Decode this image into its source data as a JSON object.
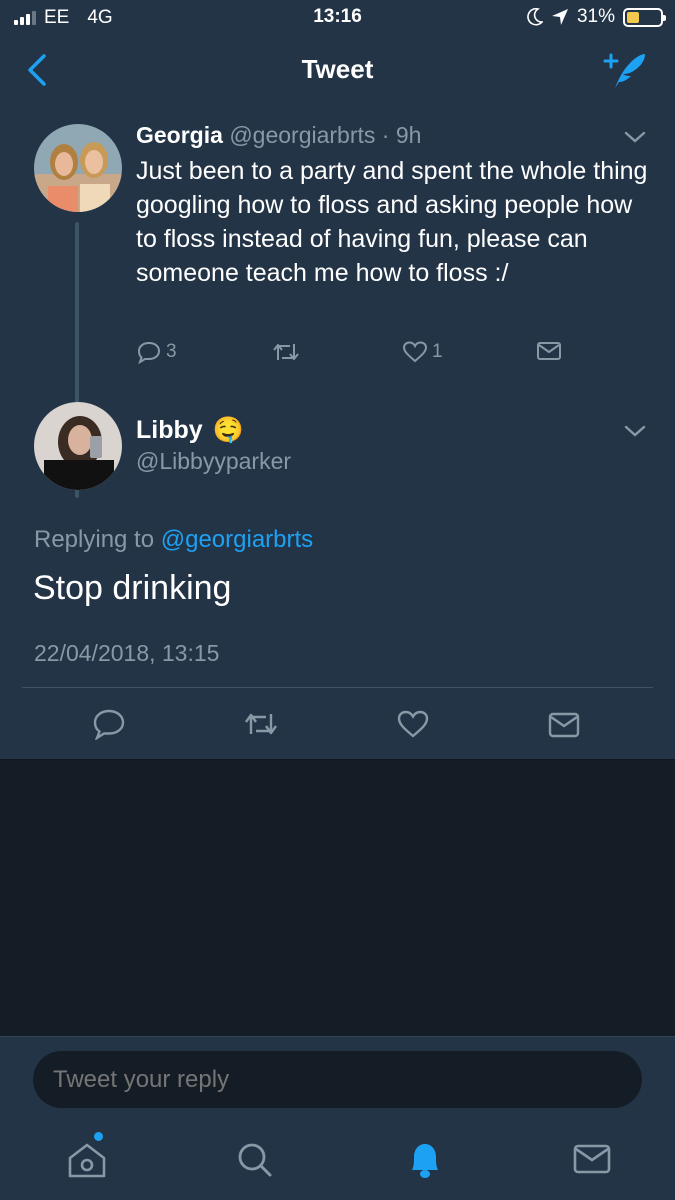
{
  "status_bar": {
    "carrier": "EE",
    "network": "4G",
    "time": "13:16",
    "battery": "31%"
  },
  "nav": {
    "title": "Tweet"
  },
  "tweet": {
    "name": "Georgia",
    "handle": "@georgiarbrts",
    "separator": "·",
    "age": "9h",
    "text": "Just been to a party and spent the whole thing googling how to floss and asking people how to floss instead of having fun, please can someone teach me how to floss :/",
    "reply_count": "3",
    "like_count": "1"
  },
  "reply": {
    "name": "Libby",
    "emoji": "🤤",
    "handle": "@Libbyyparker",
    "replying_prefix": "Replying to",
    "replying_handle": "@georgiarbrts",
    "text": "Stop drinking",
    "timestamp": "22/04/2018, 13:15"
  },
  "compose": {
    "placeholder": "Tweet your reply"
  },
  "colors": {
    "background": "#141d26",
    "panel": "#243447",
    "accent": "#1da1f2",
    "muted": "#8899a6"
  }
}
